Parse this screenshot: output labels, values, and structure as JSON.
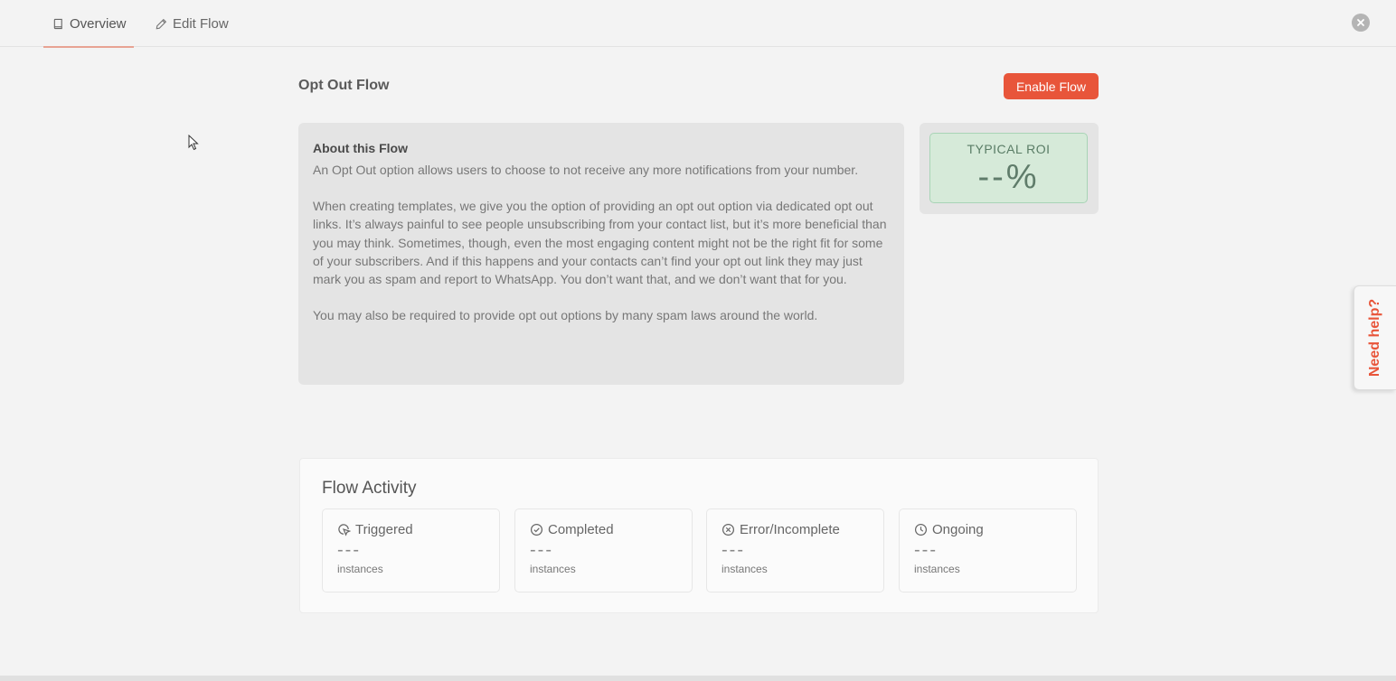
{
  "tabs": {
    "overview": "Overview",
    "edit_flow": "Edit Flow"
  },
  "flow": {
    "title": "Opt Out Flow",
    "enable_button": "Enable Flow"
  },
  "about": {
    "heading": "About this Flow",
    "paragraphs": [
      "An Opt Out option allows users to choose to not receive any more notifications from your number.",
      "When creating templates, we give you the option of providing an opt out option via dedicated opt out links. It’s always painful to see people unsubscribing from your contact list, but it’s more beneficial than you may think. Sometimes, though, even the most engaging content might not be the right fit for some of your subscribers. And if this happens and your contacts can’t find your opt out link they may just mark you as spam and report to WhatsApp. You don’t want that, and we don’t want that for you.",
      "You may also be required to provide opt out options by many spam laws around the world."
    ]
  },
  "roi": {
    "label": "TYPICAL ROI",
    "value": "--%"
  },
  "help": {
    "label": "Need help?"
  },
  "activity": {
    "title": "Flow Activity",
    "stats": [
      {
        "label": "Triggered",
        "value": "---",
        "unit": "instances",
        "icon": "cursor-click-icon"
      },
      {
        "label": "Completed",
        "value": "---",
        "unit": "instances",
        "icon": "check-circle-icon"
      },
      {
        "label": "Error/Incomplete",
        "value": "---",
        "unit": "instances",
        "icon": "x-circle-icon"
      },
      {
        "label": "Ongoing",
        "value": "---",
        "unit": "instances",
        "icon": "clock-icon"
      }
    ]
  },
  "colors": {
    "accent": "#e8553a",
    "tab_underline": "#e8a393",
    "roi_bg": "#d6ead9",
    "roi_text": "#5f7c6a"
  }
}
